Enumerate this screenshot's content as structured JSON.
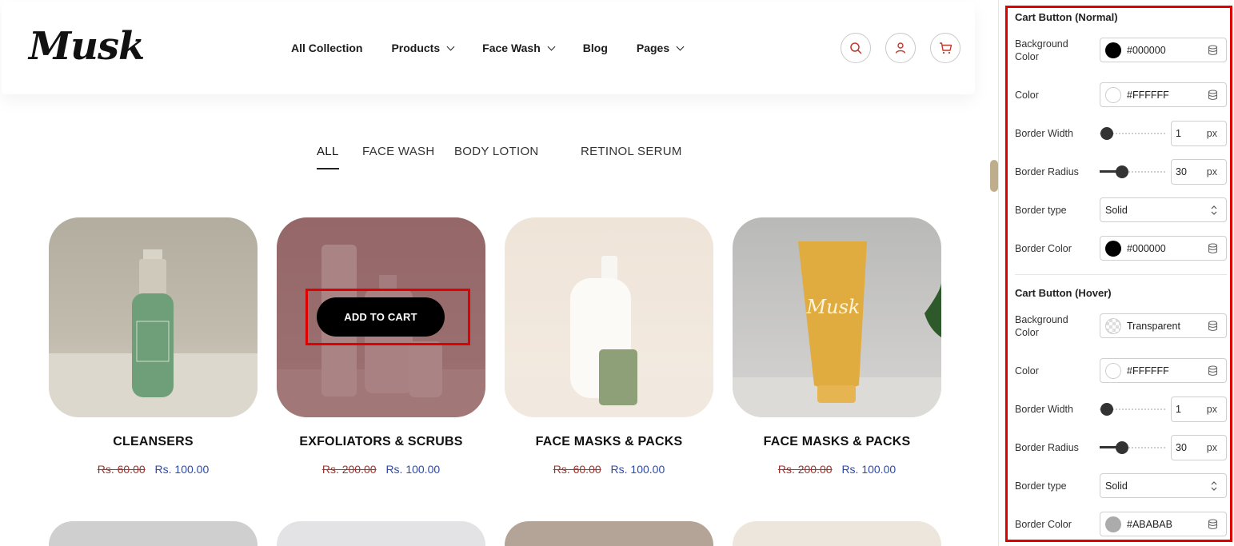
{
  "brand": {
    "logo_text": "Musk"
  },
  "nav": {
    "items": [
      {
        "label": "All Collection",
        "has_dropdown": false
      },
      {
        "label": "Products",
        "has_dropdown": true
      },
      {
        "label": "Face Wash",
        "has_dropdown": true
      },
      {
        "label": "Blog",
        "has_dropdown": false
      },
      {
        "label": "Pages",
        "has_dropdown": true
      }
    ]
  },
  "header_icons": [
    "search-icon",
    "user-icon",
    "cart-icon"
  ],
  "tabs": [
    "ALL",
    "FACE WASH",
    "BODY LOTION",
    "RETINOL SERUM"
  ],
  "active_tab": "ALL",
  "products": [
    {
      "name": "CLEANSERS",
      "old_price": "Rs. 60.00",
      "price": "Rs. 100.00",
      "bg": "#bab3a5"
    },
    {
      "name": "EXFOLIATORS & SCRUBS",
      "old_price": "Rs. 200.00",
      "price": "Rs. 100.00",
      "bg": "#7c5256",
      "hover_button": "ADD TO CART"
    },
    {
      "name": "FACE MASKS & PACKS",
      "old_price": "Rs. 60.00",
      "price": "Rs. 100.00",
      "bg": "#efe3d7"
    },
    {
      "name": "FACE MASKS & PACKS",
      "old_price": "Rs. 200.00",
      "price": "Rs. 100.00",
      "bg": "#c6c5c3"
    }
  ],
  "panel": {
    "normal": {
      "title": "Cart Button (Normal)",
      "background_color_label": "Background Color",
      "background_color": "#000000",
      "color_label": "Color",
      "color": "#FFFFFF",
      "border_width_label": "Border Width",
      "border_width": "1",
      "border_radius_label": "Border Radius",
      "border_radius": "30",
      "border_type_label": "Border type",
      "border_type": "Solid",
      "border_color_label": "Border Color",
      "border_color": "#000000",
      "unit": "px"
    },
    "hover": {
      "title": "Cart Button (Hover)",
      "background_color_label": "Background Color",
      "background_color": "Transparent",
      "color_label": "Color",
      "color": "#FFFFFF",
      "border_width_label": "Border Width",
      "border_width": "1",
      "border_radius_label": "Border Radius",
      "border_radius": "30",
      "border_type_label": "Border type",
      "border_type": "Solid",
      "border_color_label": "Border Color",
      "border_color": "#ABABAB",
      "unit": "px"
    }
  },
  "colors": {
    "accent_red": "#e00000",
    "old_price": "#a0302a",
    "new_price": "#2b4ab0"
  }
}
